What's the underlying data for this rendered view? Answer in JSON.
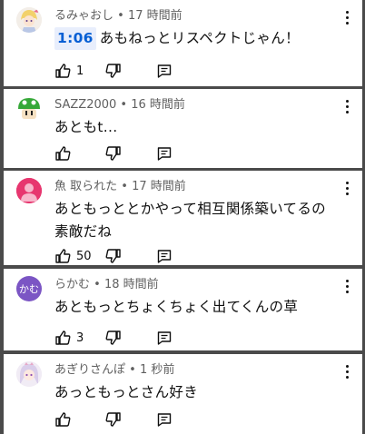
{
  "comments": [
    {
      "author": "るみゃおし",
      "time": "17 時間前",
      "timestamp_link": "1:06",
      "text": "あもねっとリスペクトじゃん！",
      "likes": "1",
      "avatar": "anime-avatar-icon"
    },
    {
      "author": "SAZZ2000",
      "time": "16 時間前",
      "text": "あともt...",
      "likes": "",
      "avatar": "mushroom-avatar-icon"
    },
    {
      "author": "魚 取られた",
      "time": "17 時間前",
      "text": "あともっととかやって相互関係築いてるの素敵だね",
      "likes": "50",
      "avatar": "default-person-avatar-icon",
      "avatar_color": "#e7366f"
    },
    {
      "author": "らかむ",
      "time": "18 時間前",
      "text": "あともっとちょくちょく出てくんの草",
      "likes": "3",
      "avatar": "text-avatar",
      "avatar_label": "かむ",
      "avatar_color": "#7b55c4"
    },
    {
      "author": "あぎりさんぽ",
      "time": "1 秒前",
      "text": "あっともっとさん好き",
      "likes": "",
      "avatar": "anime-avatar-icon"
    }
  ],
  "separator": " • "
}
